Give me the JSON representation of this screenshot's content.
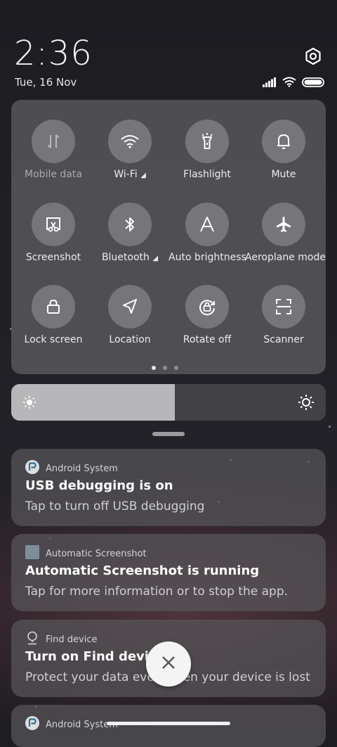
{
  "status": {
    "time": "2:36",
    "date": "Tue, 16 Nov"
  },
  "quick_settings": {
    "tiles": [
      {
        "label": "Mobile data",
        "icon": "mobile-data-icon",
        "enabled": false
      },
      {
        "label": "Wi-Fi",
        "icon": "wifi-icon",
        "has_expand": true
      },
      {
        "label": "Flashlight",
        "icon": "flashlight-icon"
      },
      {
        "label": "Mute",
        "icon": "bell-icon"
      },
      {
        "label": "Screenshot",
        "icon": "screenshot-icon"
      },
      {
        "label": "Bluetooth",
        "icon": "bluetooth-icon",
        "has_expand": true
      },
      {
        "label": "Auto brightness",
        "icon": "auto-brightness-icon"
      },
      {
        "label": "Aeroplane mode",
        "icon": "aeroplane-icon"
      },
      {
        "label": "Lock screen",
        "icon": "lock-icon"
      },
      {
        "label": "Location",
        "icon": "location-icon"
      },
      {
        "label": "Rotate off",
        "icon": "rotate-icon"
      },
      {
        "label": "Scanner",
        "icon": "scanner-icon"
      }
    ],
    "page_count": 3,
    "current_page": 1
  },
  "brightness": {
    "level": 0.52
  },
  "notifications": [
    {
      "app": "Android System",
      "title": "USB debugging is on",
      "text": "Tap to turn off USB debugging"
    },
    {
      "app": "Automatic Screenshot",
      "title": "Automatic Screenshot is running",
      "text": "Tap for more information or to stop the app."
    },
    {
      "app": "Find device",
      "title": "Turn on Find device",
      "text": "Protect your data even when your device is lost"
    },
    {
      "app": "Android System",
      "title": "",
      "text": ""
    }
  ],
  "colors": {
    "panel": "#5c5c60",
    "tile": "#96969a",
    "brightness_fill": "#b7b7b9"
  }
}
